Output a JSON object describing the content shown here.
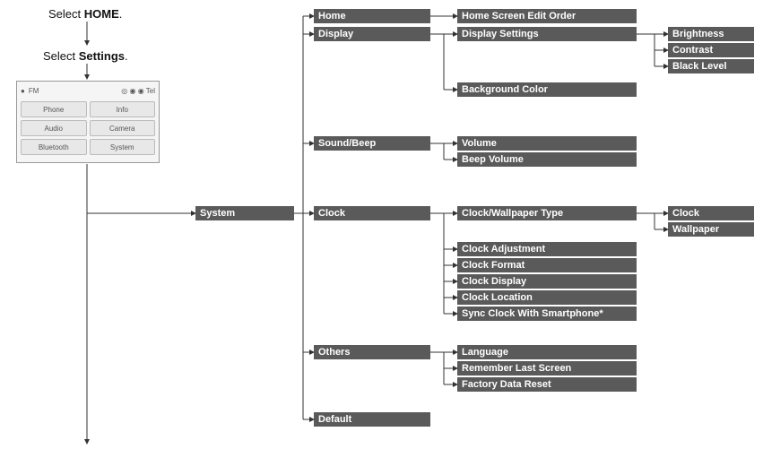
{
  "steps": {
    "step1_pre": "Select ",
    "step1_bold": "HOME",
    "step1_post": ".",
    "step2_pre": "Select ",
    "step2_bold": "Settings",
    "step2_post": "."
  },
  "mock": {
    "mode": "FM",
    "icons": "◎ ◉ ◉ Tel",
    "buttons": [
      "Phone",
      "Info",
      "Audio",
      "Camera",
      "Bluetooth",
      "System"
    ]
  },
  "col1": {
    "system": "System"
  },
  "col2": {
    "home": "Home",
    "display": "Display",
    "sound": "Sound/Beep",
    "clock": "Clock",
    "others": "Others",
    "default": "Default"
  },
  "col3": {
    "home_edit": "Home Screen Edit Order",
    "disp_settings": "Display Settings",
    "bg_color": "Background Color",
    "volume": "Volume",
    "beep_vol": "Beep Volume",
    "cw_type": "Clock/Wallpaper Type",
    "clock_adj": "Clock Adjustment",
    "clock_fmt": "Clock Format",
    "clock_disp": "Clock Display",
    "clock_loc": "Clock Location",
    "sync_sp": "Sync Clock With Smartphone*",
    "language": "Language",
    "remember": "Remember Last Screen",
    "factory": "Factory Data Reset"
  },
  "col4": {
    "brightness": "Brightness",
    "contrast": "Contrast",
    "black": "Black Level",
    "clock": "Clock",
    "wallpaper": "Wallpaper"
  },
  "chart_data": {
    "type": "tree",
    "title": "Settings menu navigation tree",
    "root_path": [
      "HOME",
      "Settings"
    ],
    "root": {
      "name": "System",
      "children": [
        {
          "name": "Home",
          "children": [
            {
              "name": "Home Screen Edit Order"
            }
          ]
        },
        {
          "name": "Display",
          "children": [
            {
              "name": "Display Settings",
              "children": [
                {
                  "name": "Brightness"
                },
                {
                  "name": "Contrast"
                },
                {
                  "name": "Black Level"
                }
              ]
            },
            {
              "name": "Background Color"
            }
          ]
        },
        {
          "name": "Sound/Beep",
          "children": [
            {
              "name": "Volume"
            },
            {
              "name": "Beep Volume"
            }
          ]
        },
        {
          "name": "Clock",
          "children": [
            {
              "name": "Clock/Wallpaper Type",
              "children": [
                {
                  "name": "Clock"
                },
                {
                  "name": "Wallpaper"
                }
              ]
            },
            {
              "name": "Clock Adjustment"
            },
            {
              "name": "Clock Format"
            },
            {
              "name": "Clock Display"
            },
            {
              "name": "Clock Location"
            },
            {
              "name": "Sync Clock With Smartphone*"
            }
          ]
        },
        {
          "name": "Others",
          "children": [
            {
              "name": "Language"
            },
            {
              "name": "Remember Last Screen"
            },
            {
              "name": "Factory Data Reset"
            }
          ]
        },
        {
          "name": "Default"
        }
      ]
    }
  }
}
